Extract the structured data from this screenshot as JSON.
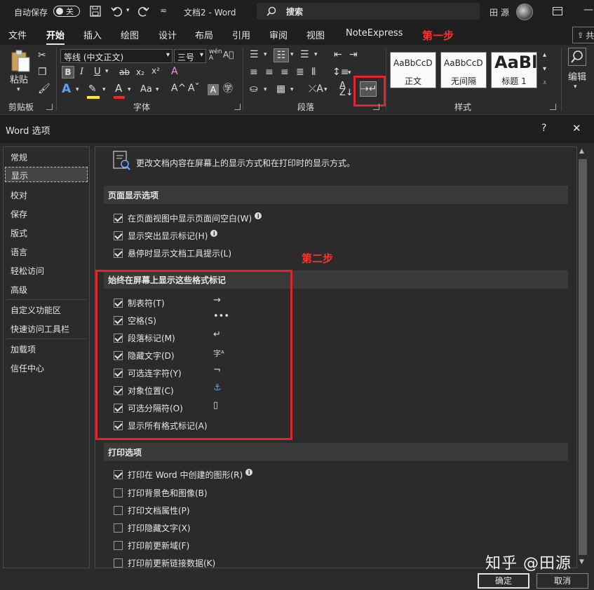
{
  "titlebar": {
    "autosave_label": "自动保存",
    "autosave_state": "关",
    "doc_title": "文档2 - Word",
    "search_label": "搜索",
    "user_name": "田 源"
  },
  "tabs": [
    {
      "label": "文件"
    },
    {
      "label": "开始"
    },
    {
      "label": "插入"
    },
    {
      "label": "绘图"
    },
    {
      "label": "设计"
    },
    {
      "label": "布局"
    },
    {
      "label": "引用"
    },
    {
      "label": "审阅"
    },
    {
      "label": "视图"
    },
    {
      "label": "NoteExpress"
    }
  ],
  "share_label": "共",
  "ribbon": {
    "paste_label": "粘贴",
    "clipboard_label": "剪贴板",
    "font_name": "等线 (中文正文)",
    "font_size": "三号",
    "font_label": "字体",
    "paragraph_label": "段落",
    "styles_label": "样式",
    "edit_label": "编辑",
    "styles": [
      {
        "sample": "AaBbCcD",
        "name": "正文"
      },
      {
        "sample": "AaBbCcD",
        "name": "无间隔"
      },
      {
        "sample": "AaBl",
        "name": "标题 1"
      }
    ]
  },
  "annotations": {
    "step1": "第一步",
    "step2": "第二步"
  },
  "dialog": {
    "title": "Word 选项",
    "help": "?",
    "close": "✕",
    "header_text": "更改文档内容在屏幕上的显示方式和在打印时的显示方式。",
    "nav": [
      {
        "label": "常规"
      },
      {
        "label": "显示"
      },
      {
        "label": "校对"
      },
      {
        "label": "保存"
      },
      {
        "label": "版式"
      },
      {
        "label": "语言"
      },
      {
        "label": "轻松访问"
      },
      {
        "label": "高级"
      },
      {
        "label": "自定义功能区"
      },
      {
        "label": "快速访问工具栏"
      },
      {
        "label": "加载项"
      },
      {
        "label": "信任中心"
      }
    ],
    "section_page": "页面显示选项",
    "page_options": [
      {
        "label": "在页面视图中显示页面间空白(W)",
        "checked": true
      },
      {
        "label": "显示突出显示标记(H)",
        "checked": true
      },
      {
        "label": "悬停时显示文档工具提示(L)",
        "checked": true
      }
    ],
    "section_marks": "始终在屏幕上显示这些格式标记",
    "mark_options": [
      {
        "label": "制表符(T)",
        "symbol": "→",
        "checked": true
      },
      {
        "label": "空格(S)",
        "symbol": "•••",
        "checked": true
      },
      {
        "label": "段落标记(M)",
        "symbol": "↵",
        "checked": true
      },
      {
        "label": "隐藏文字(D)",
        "symbol": "字ᴬ",
        "checked": true
      },
      {
        "label": "可选连字符(Y)",
        "symbol": "¬",
        "checked": true
      },
      {
        "label": "对象位置(C)",
        "symbol": "⚓",
        "checked": true
      },
      {
        "label": "可选分隔符(O)",
        "symbol": "▯",
        "checked": true
      },
      {
        "label": "显示所有格式标记(A)",
        "checked": true
      }
    ],
    "section_print": "打印选项",
    "print_options": [
      {
        "label": "打印在 Word 中创建的图形(R)",
        "checked": true
      },
      {
        "label": "打印背景色和图像(B)",
        "checked": false
      },
      {
        "label": "打印文档属性(P)",
        "checked": false
      },
      {
        "label": "打印隐藏文字(X)",
        "checked": false
      },
      {
        "label": "打印前更新域(F)",
        "checked": false
      },
      {
        "label": "打印前更新链接数据(K)",
        "checked": false
      }
    ],
    "ok_label": "确定",
    "cancel_label": "取消"
  },
  "watermark": "知乎 @田源"
}
